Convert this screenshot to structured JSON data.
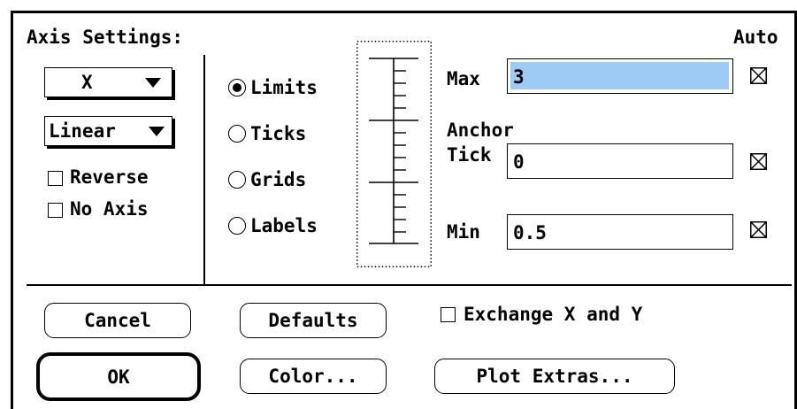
{
  "dialog": {
    "title": "Axis Settings:",
    "auto_label": "Auto"
  },
  "axis_popup": {
    "value": "X"
  },
  "scale_popup": {
    "value": "Linear"
  },
  "checks": {
    "reverse_label": "Reverse",
    "reverse_checked": false,
    "noaxis_label": "No Axis",
    "noaxis_checked": false
  },
  "radios": [
    {
      "label": "Limits",
      "selected": true
    },
    {
      "label": "Ticks",
      "selected": false
    },
    {
      "label": "Grids",
      "selected": false
    },
    {
      "label": "Labels",
      "selected": false
    }
  ],
  "fields": {
    "max_label": "Max",
    "max_value": "3",
    "max_auto": true,
    "anchor_label": "Anchor",
    "tick_label": "Tick",
    "anchor_value": "0",
    "anchor_auto": true,
    "min_label": "Min",
    "min_value": "0.5",
    "min_auto": true
  },
  "buttons": {
    "cancel": "Cancel",
    "ok": "OK",
    "defaults": "Defaults",
    "color": "Color...",
    "plot_extras": "Plot Extras..."
  },
  "exchange": {
    "label": "Exchange X and Y",
    "checked": false
  },
  "colors": {
    "selection": "#9ecbf5"
  }
}
